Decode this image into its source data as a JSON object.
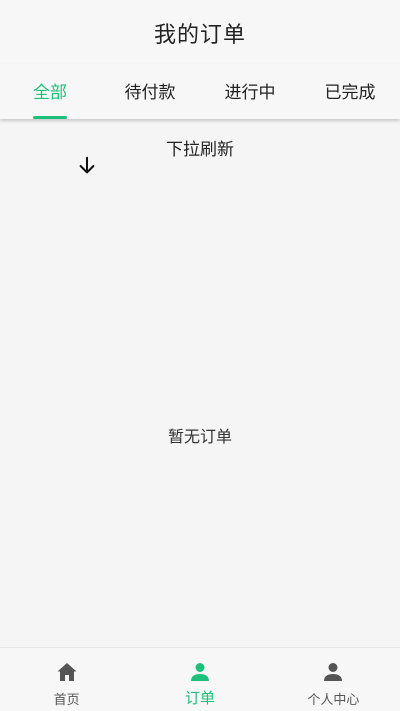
{
  "header": {
    "title": "我的订单"
  },
  "tabs": [
    {
      "label": "全部",
      "active": true
    },
    {
      "label": "待付款",
      "active": false
    },
    {
      "label": "进行中",
      "active": false
    },
    {
      "label": "已完成",
      "active": false
    }
  ],
  "refresh": {
    "label": "下拉刷新",
    "icon": "arrow-down-icon"
  },
  "empty": {
    "label": "暂无订单"
  },
  "bottom_nav": [
    {
      "label": "首页",
      "icon": "home-icon",
      "active": false
    },
    {
      "label": "订单",
      "icon": "user-icon",
      "active": true
    },
    {
      "label": "个人中心",
      "icon": "person-icon",
      "active": false
    }
  ],
  "colors": {
    "accent": "#1dc07a",
    "text": "#222222",
    "icon_inactive": "#555555"
  }
}
